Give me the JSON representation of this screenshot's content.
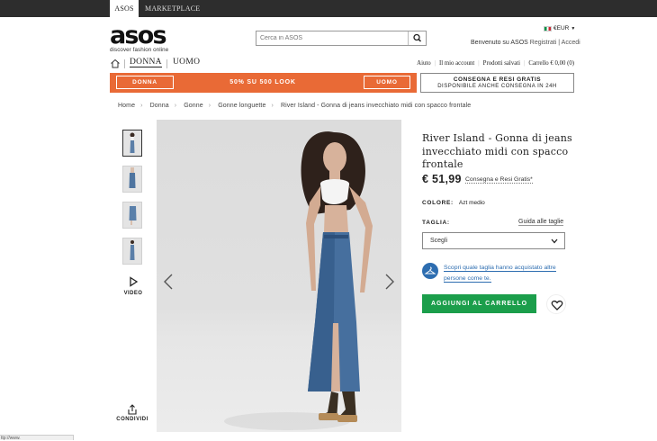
{
  "topbar": {
    "tabs": [
      "ASOS",
      "MARKETPLACE"
    ]
  },
  "header": {
    "logo_word": "asos",
    "logo_tagline": "discover fashion online",
    "search_placeholder": "Cerca in ASOS",
    "currency": "€EUR",
    "welcome": "Benvenuto su ASOS",
    "account_links": "Registrati | Accedi"
  },
  "nav": {
    "tabs": [
      "DONNA",
      "UOMO"
    ],
    "links": [
      "Aiuto",
      "Il mio account",
      "Prodotti salvati",
      "Carrello € 0,00 (0)"
    ]
  },
  "promo": {
    "left_button": "DONNA",
    "message": "50% SU 500 LOOK",
    "right_button": "UOMO",
    "shipping_line1": "CONSEGNA E RESI GRATIS",
    "shipping_line2": "DISPONIBILE ANCHE CONSEGNA IN 24H"
  },
  "breadcrumb": [
    "Home",
    "Donna",
    "Gonne",
    "Gonne longuette",
    "River Island - Gonna di jeans invecchiato midi con spacco frontale"
  ],
  "gallery": {
    "video_label": "VIDEO",
    "share_label": "CONDIVIDI"
  },
  "product": {
    "title": "River Island - Gonna di jeans invecchiato midi con spacco frontale",
    "price": "€ 51,99",
    "price_note": "Consegna e Resi Gratis*",
    "colour_label": "COLORE:",
    "colour_value": "Azt medio",
    "size_label": "TAGLIA:",
    "size_guide": "Guida alle taglie",
    "size_select": "Scegli",
    "fit_link": "Scopri quale taglia hanno acquistato altre persone come te.",
    "add_to_cart": "AGGIUNGI AL CARRELLO"
  },
  "statusbar": "ttp://www.",
  "colors": {
    "promo": "#e96a36",
    "cta": "#1b9e4b",
    "link": "#2d6db0",
    "topbar": "#2d2d2d"
  }
}
